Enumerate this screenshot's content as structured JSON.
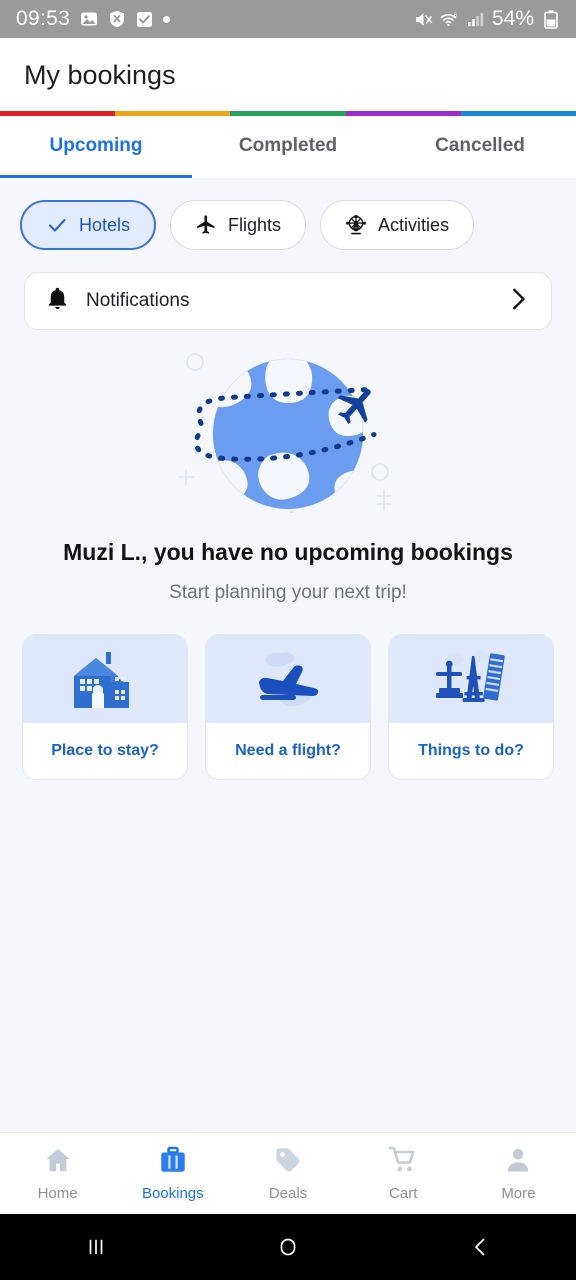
{
  "status_bar": {
    "time": "09:53",
    "battery_percent": "54%",
    "left_icons": [
      "photo-icon",
      "shield-x-icon",
      "checkbox-icon",
      "dot-icon"
    ],
    "right_icons": [
      "mute-icon",
      "wifi-6-icon",
      "signal-bars-icon",
      "battery-icon"
    ],
    "background_color": "#9a9a9a"
  },
  "header": {
    "title": "My bookings",
    "stripe_colors": [
      "#e02020",
      "#eda617",
      "#28a05a",
      "#9c2bd0",
      "#1189d6"
    ]
  },
  "tabs": [
    {
      "label": "Upcoming",
      "active": true
    },
    {
      "label": "Completed",
      "active": false
    },
    {
      "label": "Cancelled",
      "active": false
    }
  ],
  "filter_chips": [
    {
      "label": "Hotels",
      "icon": "check-icon",
      "selected": true
    },
    {
      "label": "Flights",
      "icon": "airplane-icon",
      "selected": false
    },
    {
      "label": "Activities",
      "icon": "ferris-wheel-icon",
      "selected": false
    }
  ],
  "notifications_row": {
    "label": "Notifications",
    "icon": "bell-icon",
    "chevron": "chevron-right-icon"
  },
  "illustration": {
    "name": "globe-with-airplane-illustration",
    "globe_color": "#6a9cf0",
    "airplane_color": "#12409a",
    "orbit_color": "#123a8c"
  },
  "empty_state": {
    "title": "Muzi L., you have no upcoming bookings",
    "subtitle": "Start planning your next trip!"
  },
  "suggestions": [
    {
      "label": "Place to stay?",
      "icon": "house-icon"
    },
    {
      "label": "Need a flight?",
      "icon": "takeoff-plane-icon"
    },
    {
      "label": "Things to do?",
      "icon": "landmarks-icon"
    }
  ],
  "bottom_nav": [
    {
      "label": "Home",
      "icon": "home-icon",
      "active": false
    },
    {
      "label": "Bookings",
      "icon": "suitcase-icon",
      "active": true
    },
    {
      "label": "Deals",
      "icon": "tag-icon",
      "active": false
    },
    {
      "label": "Cart",
      "icon": "cart-icon",
      "active": false
    },
    {
      "label": "More",
      "icon": "person-icon",
      "active": false
    }
  ],
  "android_nav": [
    {
      "icon": "recents-icon"
    },
    {
      "icon": "home-circle-icon"
    },
    {
      "icon": "back-icon"
    }
  ],
  "theme": {
    "accent": "#1a73e8",
    "page_background": "#f5f7fc",
    "card_background": "#ffffff",
    "muted_text": "#6f737a"
  }
}
